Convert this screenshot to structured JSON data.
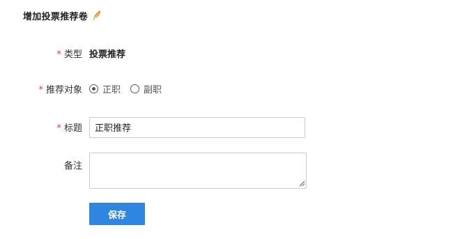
{
  "header": {
    "title": "增加投票推荐卷",
    "icon": "feather-pen-icon",
    "icon_color": "#f08a24"
  },
  "form": {
    "type": {
      "required_mark": "*",
      "label": "类型",
      "value": "投票推荐"
    },
    "target": {
      "required_mark": "*",
      "label": "推荐对象",
      "options": [
        {
          "label": "正职",
          "selected": true
        },
        {
          "label": "副职",
          "selected": false
        }
      ]
    },
    "title": {
      "required_mark": "*",
      "label": "标题",
      "value": "正职推荐"
    },
    "remark": {
      "label": "备注",
      "value": ""
    },
    "save_label": "保存"
  },
  "colors": {
    "accent": "#2f86e0",
    "required": "#e4393c"
  }
}
